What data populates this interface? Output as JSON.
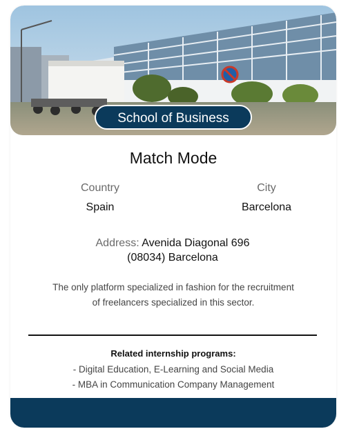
{
  "badge": {
    "label": "School of Business"
  },
  "title": "Match Mode",
  "location": {
    "country_label": "Country",
    "country_value": "Spain",
    "city_label": "City",
    "city_value": "Barcelona"
  },
  "address": {
    "label": "Address:",
    "line1": "Avenida Diagonal 696",
    "line2": "(08034) Barcelona"
  },
  "description": {
    "line1": "The only platform specialized in fashion for the recruitment",
    "line2": "of freelancers specialized in this sector."
  },
  "programs": {
    "title": "Related internship programs:",
    "items": [
      "- Digital Education, E-Learning and Social Media",
      "- MBA in Communication Company Management"
    ]
  },
  "colors": {
    "accent": "#0b3a5b"
  }
}
